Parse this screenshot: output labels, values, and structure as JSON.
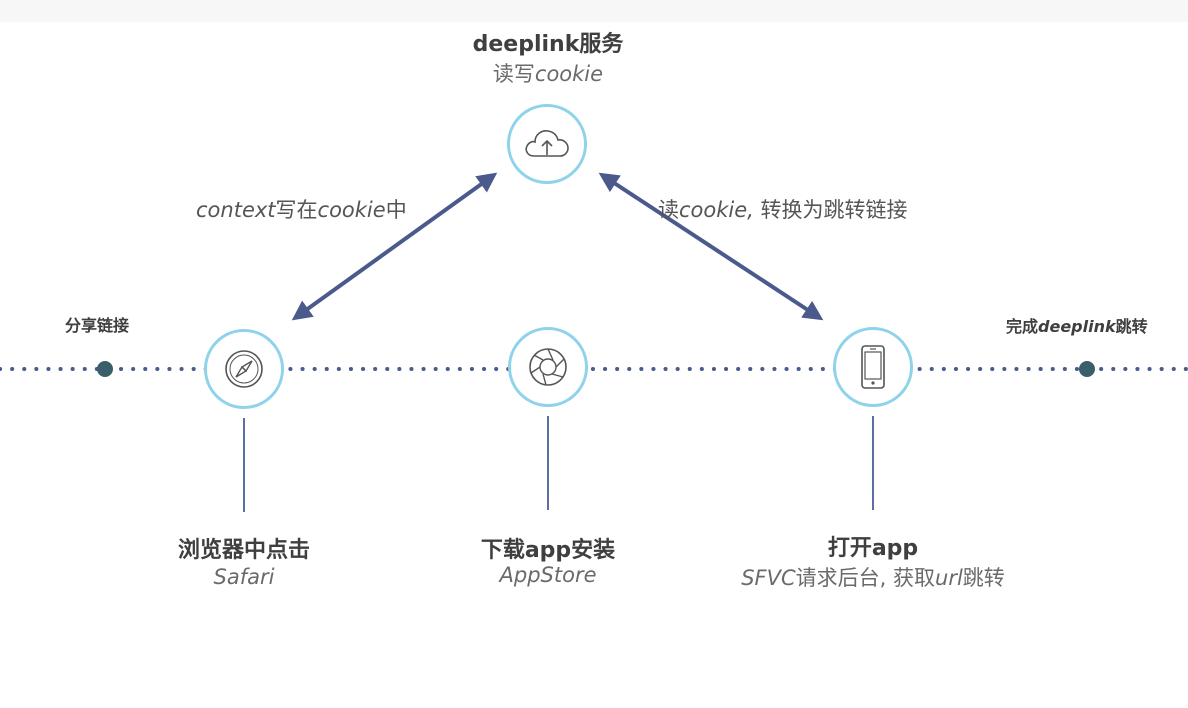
{
  "top_node": {
    "title": "deeplink服务",
    "subtitle_cn": "读写",
    "subtitle_en": "cookie",
    "icon": "cloud-upload-icon"
  },
  "left_arrow_label": {
    "en": "context",
    "cn1": "写在",
    "en2": "cookie",
    "cn2": "中"
  },
  "right_arrow_label": {
    "cn1": "读",
    "en": "cookie,",
    "cn2": " 转换为跳转链接"
  },
  "timeline": {
    "start_label": "分享链接",
    "end_label_cn1": "完成",
    "end_label_en": "deeplink",
    "end_label_cn2": "跳转"
  },
  "steps": [
    {
      "title": "浏览器中点击",
      "subtitle": "Safari",
      "icon": "compass-icon"
    },
    {
      "title": "下载app安装",
      "subtitle": "AppStore",
      "icon": "aperture-icon"
    },
    {
      "title": "打开app",
      "subtitle_en": "SFVC",
      "subtitle_cn": "请求后台, 获取",
      "subtitle_en2": "url",
      "subtitle_cn2": "跳转",
      "icon": "smartphone-icon"
    }
  ],
  "colors": {
    "ring": "#8fd3ea",
    "arrow": "#4b5a8c",
    "dot": "#3a5f6a",
    "timeline_dots": "#4b5a8c"
  }
}
